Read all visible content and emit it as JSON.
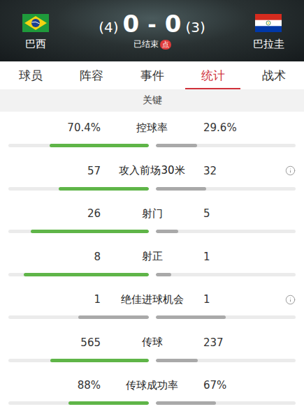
{
  "header": {
    "home": {
      "name": "巴西",
      "score": "0",
      "penalty": "(4)"
    },
    "away": {
      "name": "巴拉圭",
      "score": "0",
      "penalty": "(3)"
    },
    "separator": "-",
    "status": "已结束",
    "badge": "点"
  },
  "tabs": [
    {
      "label": "球员",
      "selected": false
    },
    {
      "label": "阵容",
      "selected": false
    },
    {
      "label": "事件",
      "selected": false
    },
    {
      "label": "统计",
      "selected": true
    },
    {
      "label": "战术",
      "selected": false
    }
  ],
  "section": {
    "title": "关键"
  },
  "stats": [
    {
      "label": "控球率",
      "info": false,
      "home": {
        "value": "70.4%",
        "level": 0.704,
        "highlight": true
      },
      "away": {
        "value": "29.6%",
        "level": 0.296,
        "highlight": false
      }
    },
    {
      "label": "攻入前场30米",
      "info": true,
      "home": {
        "value": "57",
        "level": 0.64,
        "highlight": true
      },
      "away": {
        "value": "32",
        "level": 0.36,
        "highlight": false
      }
    },
    {
      "label": "射门",
      "info": false,
      "home": {
        "value": "26",
        "level": 0.84,
        "highlight": true
      },
      "away": {
        "value": "5",
        "level": 0.16,
        "highlight": false
      }
    },
    {
      "label": "射正",
      "info": false,
      "home": {
        "value": "8",
        "level": 0.89,
        "highlight": true
      },
      "away": {
        "value": "1",
        "level": 0.11,
        "highlight": false
      }
    },
    {
      "label": "绝佳进球机会",
      "info": true,
      "home": {
        "value": "1",
        "level": 0.5,
        "highlight": false
      },
      "away": {
        "value": "1",
        "level": 0.5,
        "highlight": false
      }
    },
    {
      "label": "传球",
      "info": false,
      "home": {
        "value": "565",
        "level": 0.7,
        "highlight": true
      },
      "away": {
        "value": "237",
        "level": 0.3,
        "highlight": false
      }
    },
    {
      "label": "传球成功率",
      "info": false,
      "home": {
        "value": "88%",
        "level": 0.57,
        "highlight": true
      },
      "away": {
        "value": "67%",
        "level": 0.43,
        "highlight": false
      }
    }
  ]
}
